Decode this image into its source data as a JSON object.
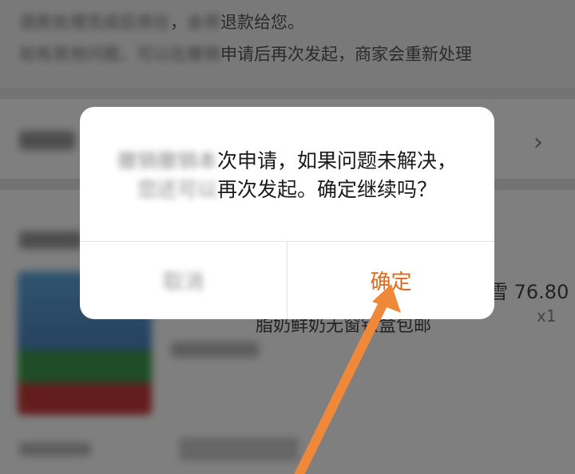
{
  "background": {
    "notice_line_1_end": "退款给您。",
    "notice_line_2_end": "申请后再次发起，商家会重新处理",
    "product": {
      "price": "76.80",
      "price_prefix": "雪",
      "quantity": "x1",
      "name_visible": "脂奶鲜奶无窗铁盒包邮"
    }
  },
  "dialog": {
    "message_line_1": "次申请，如果问题未解决，",
    "message_line_2": "再次发起。确定继续吗？",
    "cancel_label": "取消",
    "confirm_label": "确定"
  },
  "colors": {
    "accent": "#e06a1c",
    "arrow": "#f0883a"
  }
}
